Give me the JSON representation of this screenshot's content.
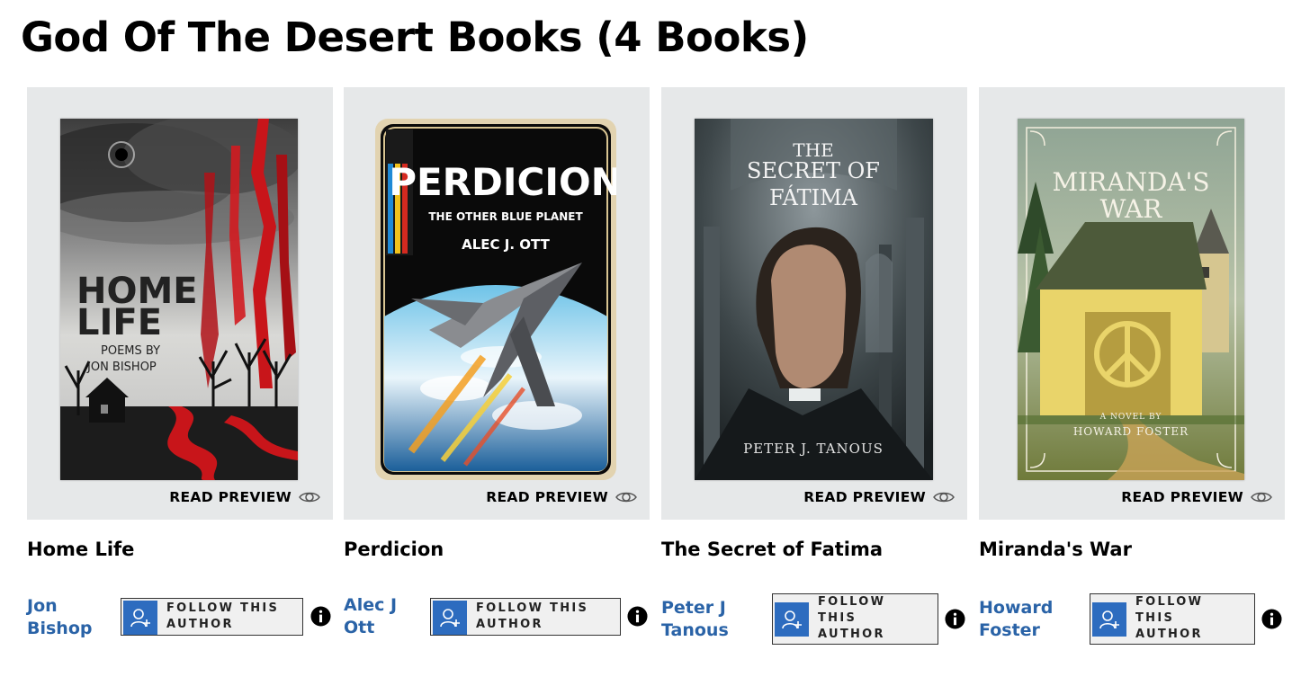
{
  "page": {
    "title": "God Of The Desert Books (4 Books)"
  },
  "read_preview_label": "READ PREVIEW",
  "follow_label": "FOLLOW THIS AUTHOR",
  "colors": {
    "author_link": "#2a63a7",
    "follow_icon_bg": "#2d6cbf",
    "panel_bg": "#e6e8e9"
  },
  "books": [
    {
      "title": "Home Life",
      "author": "Jon Bishop",
      "cover": {
        "title_line1": "HOME",
        "title_line2": "LIFE",
        "subtitle_line1": "POEMS BY",
        "subtitle_line2": "JON BISHOP"
      }
    },
    {
      "title": "Perdicion",
      "author": "Alec J Ott",
      "cover": {
        "title": "PERDICION",
        "subtitle": "THE OTHER BLUE PLANET",
        "author": "ALEC J. OTT"
      }
    },
    {
      "title": "The Secret of Fatima",
      "author": "Peter J Tanous",
      "cover": {
        "title_line1": "THE",
        "title_line2": "SECRET OF",
        "title_line3": "FÁTIMA",
        "author": "PETER J. TANOUS"
      }
    },
    {
      "title": "Miranda's War",
      "author": "Howard Foster",
      "cover": {
        "title_line1": "MIRANDA'S",
        "title_line2": "WAR",
        "tagline": "A NOVEL BY",
        "author": "HOWARD FOSTER"
      }
    }
  ]
}
